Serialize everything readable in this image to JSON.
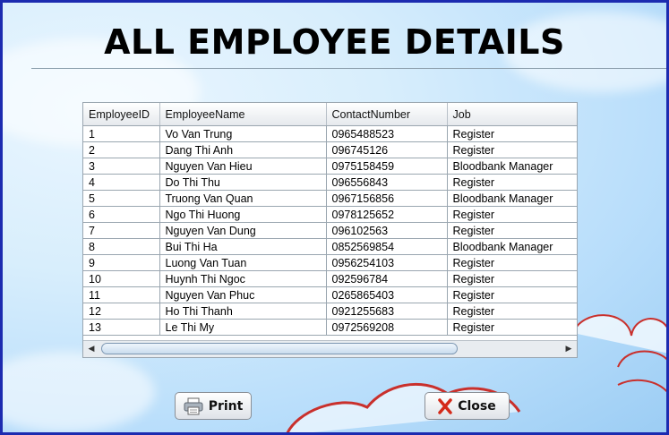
{
  "title": "ALL EMPLOYEE DETAILS",
  "table": {
    "columns": [
      "EmployeeID",
      "EmployeeName",
      "ContactNumber",
      "Job"
    ],
    "rows": [
      [
        "1",
        "Vo Van Trung",
        "0965488523",
        "Register"
      ],
      [
        "2",
        "Dang Thi Anh",
        "096745126",
        "Register"
      ],
      [
        "3",
        "Nguyen Van Hieu",
        "0975158459",
        "Bloodbank Manager"
      ],
      [
        "4",
        "Do Thi Thu",
        "096556843",
        "Register"
      ],
      [
        "5",
        "Truong Van Quan",
        "0967156856",
        "Bloodbank Manager"
      ],
      [
        "6",
        "Ngo Thi Huong",
        "0978125652",
        "Register"
      ],
      [
        "7",
        "Nguyen Van Dung",
        "096102563",
        "Register"
      ],
      [
        "8",
        "Bui Thi Ha",
        "0852569854",
        "Bloodbank Manager"
      ],
      [
        "9",
        "Luong Van Tuan",
        "0956254103",
        "Register"
      ],
      [
        "10",
        "Huynh Thi Ngoc",
        "092596784",
        "Register"
      ],
      [
        "11",
        "Nguyen Van Phuc",
        "0265865403",
        "Register"
      ],
      [
        "12",
        "Ho Thi Thanh",
        "0921255683",
        "Register"
      ],
      [
        "13",
        "Le Thi My",
        "0972569208",
        "Register"
      ]
    ]
  },
  "buttons": {
    "print": {
      "label": "Print",
      "icon": "printer-icon"
    },
    "close": {
      "label": "Close",
      "icon": "close-x-icon"
    }
  },
  "colors": {
    "border": "#1c2bb0",
    "close_x": "#d42a1a",
    "heart": "#c9302c"
  }
}
